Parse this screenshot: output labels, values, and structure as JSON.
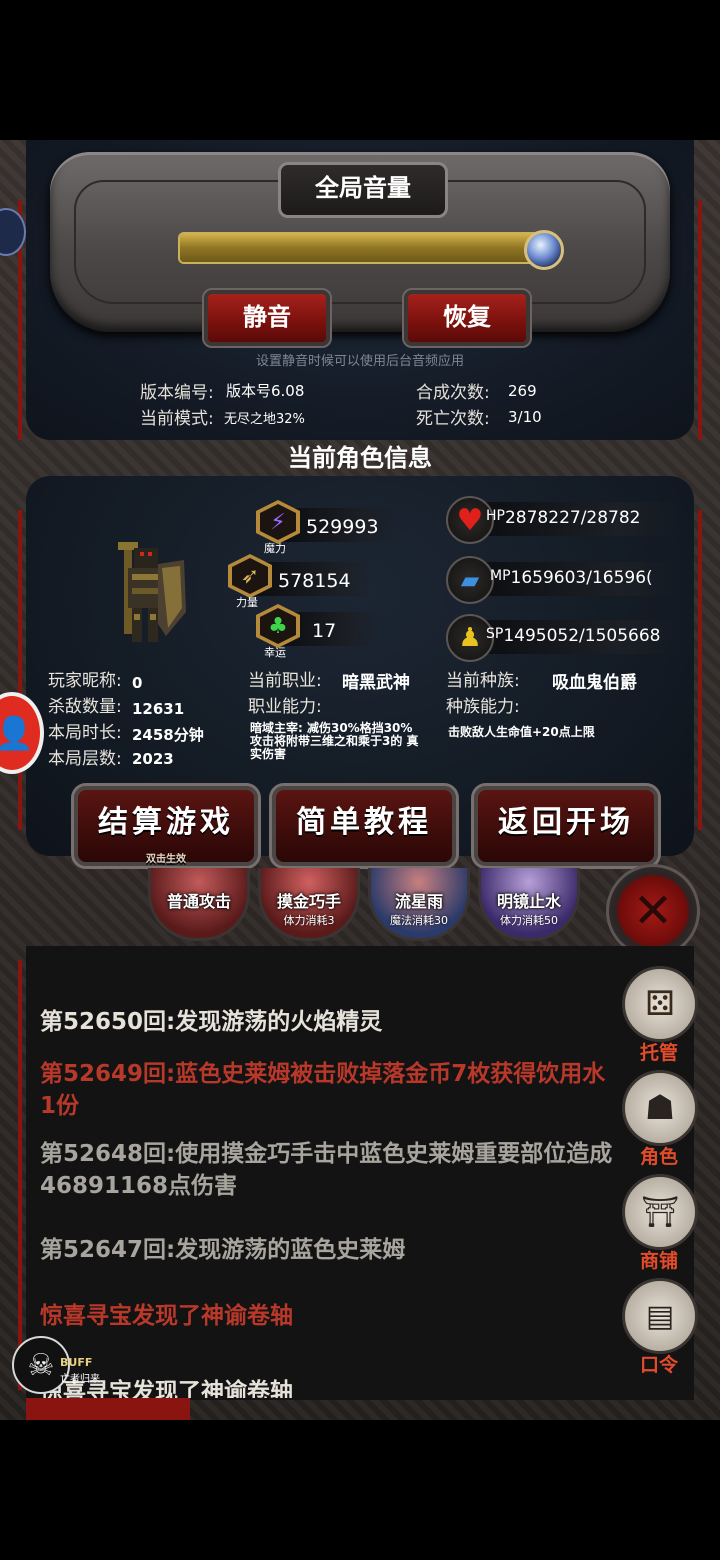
{
  "volume_panel": {
    "title": "全局音量",
    "volume_level": 0.96,
    "mute_label": "静音",
    "restore_label": "恢复",
    "hint": "设置静音时候可以使用后台音频应用"
  },
  "game_info": {
    "version_label": "版本编号:",
    "version_value": "版本号6.08",
    "mode_label": "当前模式:",
    "mode_value": "无尽之地32%",
    "synth_label": "合成次数:",
    "synth_value": "269",
    "death_label": "死亡次数:",
    "death_value": "3/10"
  },
  "character": {
    "title": "当前角色信息",
    "magic_value": "529993",
    "magic_caption": "魔力",
    "power_value": "578154",
    "power_caption": "力量",
    "luck_value": "17",
    "luck_caption": "幸运",
    "hp_label": "HP",
    "hp_value": "2878227/28782",
    "mp_label": "MP",
    "mp_value": "1659603/16596(",
    "sp_label": "SP",
    "sp_value": "1495052/1505668",
    "nickname_label": "玩家昵称:",
    "nickname_value": "0",
    "kills_label": "杀敌数量:",
    "kills_value": "12631",
    "duration_label": "本局时长:",
    "duration_value": "2458分钟",
    "floor_label": "本局层数:",
    "floor_value": "2023",
    "job_label": "当前职业:",
    "job_value": "暗黑武神",
    "job_ability_label": "职业能力:",
    "job_ability_text": "暗域主宰: 减伤30%格挡30% 攻击将附带三维之和乘于3的 真实伤害",
    "race_label": "当前种族:",
    "race_value": "吸血鬼伯爵",
    "race_ability_label": "种族能力:",
    "race_ability_text": "击败敌人生命值+20点上限"
  },
  "actions": {
    "settle_label": "结算游戏",
    "settle_sub": "双击生效",
    "tutorial_label": "简单教程",
    "return_label": "返回开场"
  },
  "skills": [
    {
      "name": "普通攻击",
      "cost": ""
    },
    {
      "name": "摸金巧手",
      "cost": "体力消耗3"
    },
    {
      "name": "流星雨",
      "cost": "魔法消耗30"
    },
    {
      "name": "明镜止水",
      "cost": "体力消耗50"
    }
  ],
  "log": [
    {
      "text": "第52650回:发现游荡的火焰精灵",
      "color": "#e6e2da"
    },
    {
      "text": "第52649回:蓝色史莱姆被击败掉落金币7枚获得饮用水1份",
      "color": "#b8382a"
    },
    {
      "text": "第52648回:使用摸金巧手击中蓝色史莱姆重要部位造成46891168点伤害",
      "color": "#a8a49e"
    },
    {
      "text": "第52647回:发现游荡的蓝色史莱姆",
      "color": "#a8a49e"
    },
    {
      "text": "惊喜寻宝发现了神谕卷轴",
      "color": "#b8382a"
    },
    {
      "text": "惊喜寻宝发现了神谕卷轴",
      "color": "#e6e2da"
    }
  ],
  "side_menu": {
    "auto_label": "托管",
    "role_label": "角色",
    "shop_label": "商铺",
    "code_label": "口令"
  },
  "buff": {
    "label": "BUFF",
    "name": "亡者归来"
  }
}
